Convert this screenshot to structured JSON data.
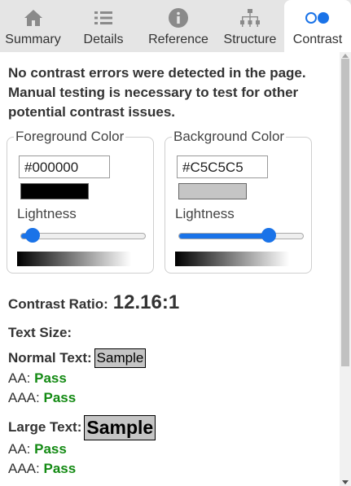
{
  "tabs": [
    {
      "label": "Summary",
      "icon": "home-icon"
    },
    {
      "label": "Details",
      "icon": "list-icon"
    },
    {
      "label": "Reference",
      "icon": "info-icon"
    },
    {
      "label": "Structure",
      "icon": "sitemap-icon"
    },
    {
      "label": "Contrast",
      "icon": "contrast-icon"
    }
  ],
  "active_tab": "Contrast",
  "summary_message": "No contrast errors were detected in the page. Manual testing is necessary to test for other potential contrast issues.",
  "foreground": {
    "legend": "Foreground Color",
    "hex": "#000000",
    "swatch_color": "#000000",
    "lightness_label": "Lightness",
    "lightness": 0.1
  },
  "background": {
    "legend": "Background Color",
    "hex": "#C5C5C5",
    "swatch_color": "#C5C5C5",
    "lightness_label": "Lightness",
    "lightness": 0.72
  },
  "contrast": {
    "label": "Contrast Ratio:",
    "value": "12.16:1"
  },
  "text_size_label": "Text Size:",
  "normal_text": {
    "label": "Normal Text:",
    "sample": "Sample",
    "aa_label": "AA:",
    "aa_result": "Pass",
    "aaa_label": "AAA:",
    "aaa_result": "Pass"
  },
  "large_text": {
    "label": "Large Text:",
    "sample": "Sample",
    "aa_label": "AA:",
    "aa_result": "Pass",
    "aaa_label": "AAA:",
    "aaa_result": "Pass"
  },
  "colors": {
    "accent": "#1a73e8",
    "pass": "#138a13",
    "tab_bar": "#e5e5e5"
  }
}
